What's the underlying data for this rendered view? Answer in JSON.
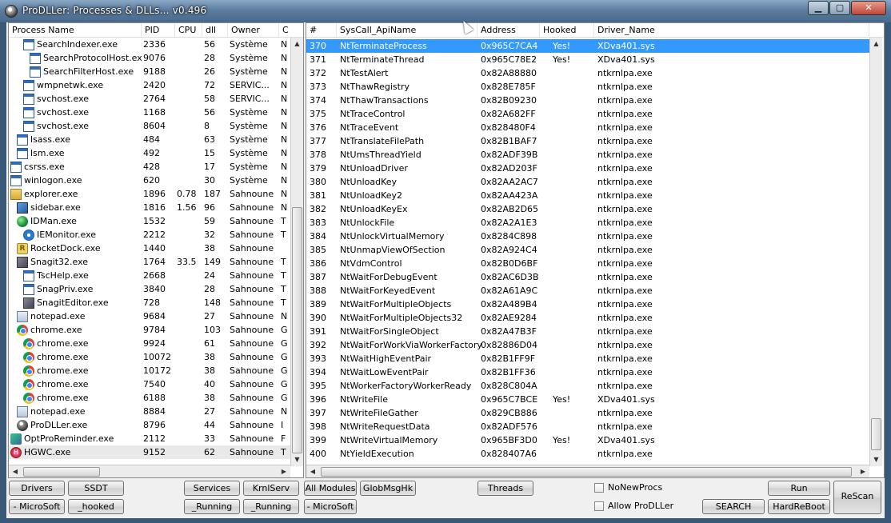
{
  "window": {
    "title": "ProDLLer: Processes & DLLs... v0.496",
    "minimize": "▁",
    "maximize": "▢",
    "close": "✕"
  },
  "left_columns": [
    "Process Name",
    "PID",
    "CPU",
    "dll",
    "Owner",
    "C"
  ],
  "processes": [
    {
      "name": "SearchIndexer.exe",
      "pid": "2336",
      "cpu": "",
      "dll": "56",
      "owner": "Système",
      "c": "N",
      "icon": "win",
      "indent": 32
    },
    {
      "name": "SearchProtocolHost.exe",
      "pid": "9076",
      "cpu": "",
      "dll": "28",
      "owner": "Système",
      "c": "N",
      "icon": "win",
      "indent": 40
    },
    {
      "name": "SearchFilterHost.exe",
      "pid": "9188",
      "cpu": "",
      "dll": "26",
      "owner": "Système",
      "c": "N",
      "icon": "win",
      "indent": 40
    },
    {
      "name": "wmpnetwk.exe",
      "pid": "2420",
      "cpu": "",
      "dll": "72",
      "owner": "SERVIC...",
      "c": "N",
      "icon": "win",
      "indent": 32
    },
    {
      "name": "svchost.exe",
      "pid": "2764",
      "cpu": "",
      "dll": "58",
      "owner": "SERVIC...",
      "c": "N",
      "icon": "win",
      "indent": 32
    },
    {
      "name": "svchost.exe",
      "pid": "1168",
      "cpu": "",
      "dll": "56",
      "owner": "Système",
      "c": "N",
      "icon": "win",
      "indent": 32
    },
    {
      "name": "svchost.exe",
      "pid": "8604",
      "cpu": "",
      "dll": "8",
      "owner": "Système",
      "c": "N",
      "icon": "win",
      "indent": 32
    },
    {
      "name": "lsass.exe",
      "pid": "484",
      "cpu": "",
      "dll": "63",
      "owner": "Système",
      "c": "N",
      "icon": "win",
      "indent": 24
    },
    {
      "name": "lsm.exe",
      "pid": "492",
      "cpu": "",
      "dll": "15",
      "owner": "Système",
      "c": "N",
      "icon": "win",
      "indent": 24
    },
    {
      "name": "csrss.exe",
      "pid": "428",
      "cpu": "",
      "dll": "17",
      "owner": "Système",
      "c": "N",
      "icon": "win",
      "indent": 16
    },
    {
      "name": "winlogon.exe",
      "pid": "620",
      "cpu": "",
      "dll": "30",
      "owner": "Système",
      "c": "N",
      "icon": "win",
      "indent": 16
    },
    {
      "name": "explorer.exe",
      "pid": "1896",
      "cpu": "0.78",
      "dll": "187",
      "owner": "Sahnoune",
      "c": "N",
      "icon": "explorer",
      "indent": 16
    },
    {
      "name": "sidebar.exe",
      "pid": "1816",
      "cpu": "1.56",
      "dll": "96",
      "owner": "Sahnoune",
      "c": "N",
      "icon": "sidebar",
      "indent": 24
    },
    {
      "name": "IDMan.exe",
      "pid": "1532",
      "cpu": "",
      "dll": "59",
      "owner": "Sahnoune",
      "c": "T",
      "icon": "globe",
      "indent": 24
    },
    {
      "name": "IEMonitor.exe",
      "pid": "2212",
      "cpu": "",
      "dll": "32",
      "owner": "Sahnoune",
      "c": "T",
      "icon": "ie",
      "indent": 32
    },
    {
      "name": "RocketDock.exe",
      "pid": "1440",
      "cpu": "",
      "dll": "38",
      "owner": "Sahnoune",
      "c": "",
      "icon": "rocket",
      "indent": 24
    },
    {
      "name": "Snagit32.exe",
      "pid": "1764",
      "cpu": "33.5",
      "dll": "149",
      "owner": "Sahnoune",
      "c": "T",
      "icon": "snag",
      "indent": 24
    },
    {
      "name": "TscHelp.exe",
      "pid": "2668",
      "cpu": "",
      "dll": "24",
      "owner": "Sahnoune",
      "c": "T",
      "icon": "win",
      "indent": 32
    },
    {
      "name": "SnagPriv.exe",
      "pid": "3840",
      "cpu": "",
      "dll": "28",
      "owner": "Sahnoune",
      "c": "T",
      "icon": "win",
      "indent": 32
    },
    {
      "name": "SnagitEditor.exe",
      "pid": "728",
      "cpu": "",
      "dll": "148",
      "owner": "Sahnoune",
      "c": "T",
      "icon": "snag",
      "indent": 32
    },
    {
      "name": "notepad.exe",
      "pid": "9684",
      "cpu": "",
      "dll": "27",
      "owner": "Sahnoune",
      "c": "N",
      "icon": "note",
      "indent": 24
    },
    {
      "name": "chrome.exe",
      "pid": "9784",
      "cpu": "",
      "dll": "103",
      "owner": "Sahnoune",
      "c": "G",
      "icon": "chrome",
      "indent": 24
    },
    {
      "name": "chrome.exe",
      "pid": "9924",
      "cpu": "",
      "dll": "61",
      "owner": "Sahnoune",
      "c": "G",
      "icon": "chrome",
      "indent": 32
    },
    {
      "name": "chrome.exe",
      "pid": "10072",
      "cpu": "",
      "dll": "38",
      "owner": "Sahnoune",
      "c": "G",
      "icon": "chrome",
      "indent": 32
    },
    {
      "name": "chrome.exe",
      "pid": "10172",
      "cpu": "",
      "dll": "38",
      "owner": "Sahnoune",
      "c": "G",
      "icon": "chrome",
      "indent": 32
    },
    {
      "name": "chrome.exe",
      "pid": "7540",
      "cpu": "",
      "dll": "40",
      "owner": "Sahnoune",
      "c": "G",
      "icon": "chrome",
      "indent": 32
    },
    {
      "name": "chrome.exe",
      "pid": "6188",
      "cpu": "",
      "dll": "38",
      "owner": "Sahnoune",
      "c": "G",
      "icon": "chrome",
      "indent": 32
    },
    {
      "name": "notepad.exe",
      "pid": "8884",
      "cpu": "",
      "dll": "27",
      "owner": "Sahnoune",
      "c": "N",
      "icon": "note",
      "indent": 24
    },
    {
      "name": "ProDLLer.exe",
      "pid": "8796",
      "cpu": "",
      "dll": "44",
      "owner": "Sahnoune",
      "c": "I",
      "icon": "pro",
      "indent": 24
    },
    {
      "name": "OptProReminder.exe",
      "pid": "2112",
      "cpu": "",
      "dll": "33",
      "owner": "Sahnoune",
      "c": "F",
      "icon": "opt",
      "indent": 16
    },
    {
      "name": "HGWC.exe",
      "pid": "9152",
      "cpu": "",
      "dll": "62",
      "owner": "Sahnoune",
      "c": "T",
      "icon": "hg",
      "indent": 16,
      "selected": true
    }
  ],
  "right_columns": [
    "#",
    "SysCall_ApiName",
    "Address",
    "Hooked",
    "Driver_Name"
  ],
  "syscalls": [
    {
      "n": "370",
      "api": "NtTerminateProcess",
      "addr": "0x965C7CA4",
      "hooked": "Yes!",
      "driver": "XDva401.sys",
      "selected": true
    },
    {
      "n": "371",
      "api": "NtTerminateThread",
      "addr": "0x965C78E2",
      "hooked": "Yes!",
      "driver": "XDva401.sys"
    },
    {
      "n": "372",
      "api": "NtTestAlert",
      "addr": "0x82A88880",
      "hooked": "",
      "driver": "ntkrnlpa.exe"
    },
    {
      "n": "373",
      "api": "NtThawRegistry",
      "addr": "0x828E785F",
      "hooked": "",
      "driver": "ntkrnlpa.exe"
    },
    {
      "n": "374",
      "api": "NtThawTransactions",
      "addr": "0x82B09230",
      "hooked": "",
      "driver": "ntkrnlpa.exe"
    },
    {
      "n": "375",
      "api": "NtTraceControl",
      "addr": "0x82A682FF",
      "hooked": "",
      "driver": "ntkrnlpa.exe"
    },
    {
      "n": "376",
      "api": "NtTraceEvent",
      "addr": "0x828480F4",
      "hooked": "",
      "driver": "ntkrnlpa.exe"
    },
    {
      "n": "377",
      "api": "NtTranslateFilePath",
      "addr": "0x82B1BAF7",
      "hooked": "",
      "driver": "ntkrnlpa.exe"
    },
    {
      "n": "378",
      "api": "NtUmsThreadYield",
      "addr": "0x82ADF39B",
      "hooked": "",
      "driver": "ntkrnlpa.exe"
    },
    {
      "n": "379",
      "api": "NtUnloadDriver",
      "addr": "0x82AD203F",
      "hooked": "",
      "driver": "ntkrnlpa.exe"
    },
    {
      "n": "380",
      "api": "NtUnloadKey",
      "addr": "0x82AA2AC7",
      "hooked": "",
      "driver": "ntkrnlpa.exe"
    },
    {
      "n": "381",
      "api": "NtUnloadKey2",
      "addr": "0x82AA423A",
      "hooked": "",
      "driver": "ntkrnlpa.exe"
    },
    {
      "n": "382",
      "api": "NtUnloadKeyEx",
      "addr": "0x82AB2D65",
      "hooked": "",
      "driver": "ntkrnlpa.exe"
    },
    {
      "n": "383",
      "api": "NtUnlockFile",
      "addr": "0x82A2A1E3",
      "hooked": "",
      "driver": "ntkrnlpa.exe"
    },
    {
      "n": "384",
      "api": "NtUnlockVirtualMemory",
      "addr": "0x8284C898",
      "hooked": "",
      "driver": "ntkrnlpa.exe"
    },
    {
      "n": "385",
      "api": "NtUnmapViewOfSection",
      "addr": "0x82A924C4",
      "hooked": "",
      "driver": "ntkrnlpa.exe"
    },
    {
      "n": "386",
      "api": "NtVdmControl",
      "addr": "0x82B0D6BF",
      "hooked": "",
      "driver": "ntkrnlpa.exe"
    },
    {
      "n": "387",
      "api": "NtWaitForDebugEvent",
      "addr": "0x82AC6D3B",
      "hooked": "",
      "driver": "ntkrnlpa.exe"
    },
    {
      "n": "388",
      "api": "NtWaitForKeyedEvent",
      "addr": "0x82A61A9C",
      "hooked": "",
      "driver": "ntkrnlpa.exe"
    },
    {
      "n": "389",
      "api": "NtWaitForMultipleObjects",
      "addr": "0x82A489B4",
      "hooked": "",
      "driver": "ntkrnlpa.exe"
    },
    {
      "n": "390",
      "api": "NtWaitForMultipleObjects32",
      "addr": "0x82AE9284",
      "hooked": "",
      "driver": "ntkrnlpa.exe"
    },
    {
      "n": "391",
      "api": "NtWaitForSingleObject",
      "addr": "0x82A47B3F",
      "hooked": "",
      "driver": "ntkrnlpa.exe"
    },
    {
      "n": "392",
      "api": "NtWaitForWorkViaWorkerFactory",
      "addr": "0x82886D04",
      "hooked": "",
      "driver": "ntkrnlpa.exe"
    },
    {
      "n": "393",
      "api": "NtWaitHighEventPair",
      "addr": "0x82B1FF9F",
      "hooked": "",
      "driver": "ntkrnlpa.exe"
    },
    {
      "n": "394",
      "api": "NtWaitLowEventPair",
      "addr": "0x82B1FF36",
      "hooked": "",
      "driver": "ntkrnlpa.exe"
    },
    {
      "n": "395",
      "api": "NtWorkerFactoryWorkerReady",
      "addr": "0x828C804A",
      "hooked": "",
      "driver": "ntkrnlpa.exe"
    },
    {
      "n": "396",
      "api": "NtWriteFile",
      "addr": "0x965C7BCE",
      "hooked": "Yes!",
      "driver": "XDva401.sys"
    },
    {
      "n": "397",
      "api": "NtWriteFileGather",
      "addr": "0x829CB886",
      "hooked": "",
      "driver": "ntkrnlpa.exe"
    },
    {
      "n": "398",
      "api": "NtWriteRequestData",
      "addr": "0x82ADF576",
      "hooked": "",
      "driver": "ntkrnlpa.exe"
    },
    {
      "n": "399",
      "api": "NtWriteVirtualMemory",
      "addr": "0x965BF3D0",
      "hooked": "Yes!",
      "driver": "XDva401.sys"
    },
    {
      "n": "400",
      "api": "NtYieldExecution",
      "addr": "0x828407A6",
      "hooked": "",
      "driver": "ntkrnlpa.exe"
    }
  ],
  "buttons": {
    "drivers": "Drivers",
    "ssdt": "SSDT",
    "ms_left": "- MicroSoft",
    "hooked": "_hooked",
    "services": "Services",
    "krnlserv": "KrnlServ",
    "running1": "_Running",
    "running2": "_Running",
    "all_modules": "All Modules",
    "globmsghk": "GlobMsgHk",
    "ms_mid": "- MicroSoft",
    "threads": "Threads",
    "run": "Run",
    "search": "SEARCH",
    "hardreboot": "HardReBoot",
    "rescan": "ReScan"
  },
  "checkboxes": {
    "nonewprocs": "NoNewProcs",
    "allow": "Allow ProDLLer"
  },
  "scroll": {
    "up": "▲",
    "down": "▼",
    "left": "◀",
    "right": "▶"
  }
}
